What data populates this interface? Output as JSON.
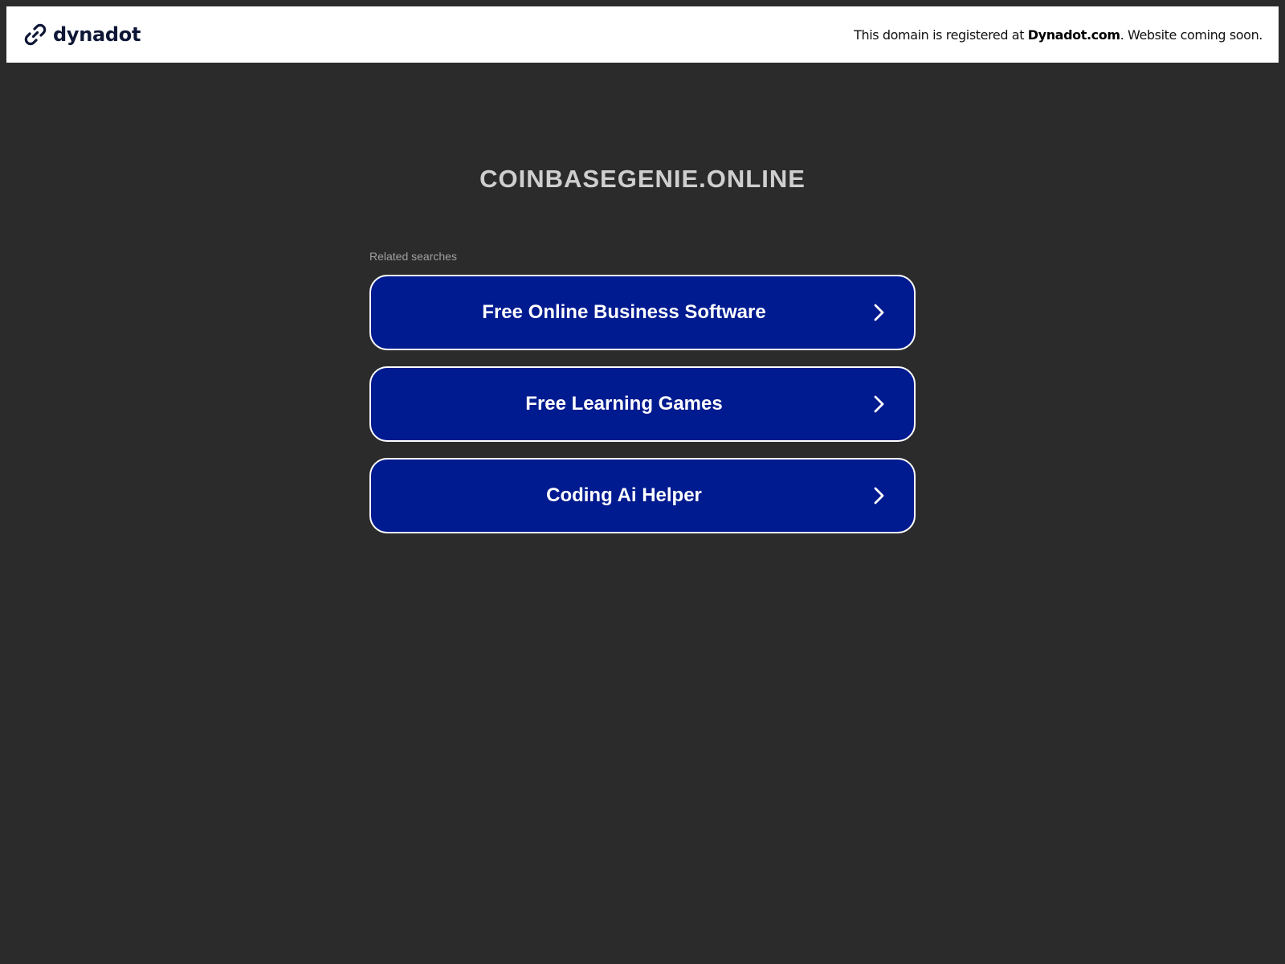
{
  "header": {
    "brand_name": "dynadot",
    "brand_icon": "link-chain-icon",
    "notice_prefix": "This domain is registered at ",
    "notice_registrar": "Dynadot.com",
    "notice_suffix": ". Website coming soon."
  },
  "main": {
    "domain": "COINBASEGENIE.ONLINE",
    "related_label": "Related searches",
    "searches": [
      {
        "label": "Free Online Business Software",
        "icon": "chevron-right-icon"
      },
      {
        "label": "Free Learning Games",
        "icon": "chevron-right-icon"
      },
      {
        "label": "Coding Ai Helper",
        "icon": "chevron-right-icon"
      }
    ]
  },
  "colors": {
    "background": "#2b2b2b",
    "header_bg": "#ffffff",
    "button_bg": "#001a8f",
    "button_border": "#ffffff",
    "brand_text": "#0e1736"
  }
}
